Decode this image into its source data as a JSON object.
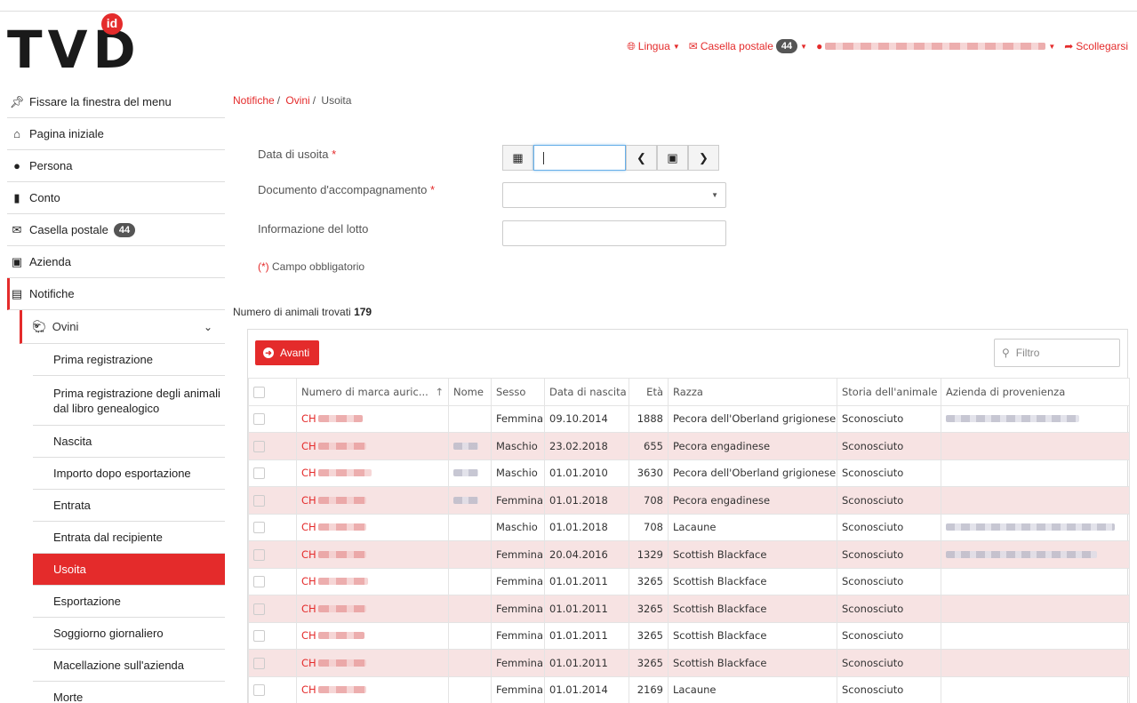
{
  "header": {
    "logo_text": "TVD",
    "logo_badge": "id",
    "lingua_label": "Lingua",
    "mailbox_label": "Casella postale",
    "mailbox_count": "44",
    "logout_label": "Scollegarsi"
  },
  "sidebar": {
    "items": [
      {
        "label": "Fissare la finestra del menu",
        "icon": "pin-icon"
      },
      {
        "label": "Pagina iniziale",
        "icon": "home-icon"
      },
      {
        "label": "Persona",
        "icon": "user-icon"
      },
      {
        "label": "Conto",
        "icon": "money-icon"
      },
      {
        "label": "Casella postale",
        "icon": "mail-icon",
        "badge": "44"
      },
      {
        "label": "Azienda",
        "icon": "factory-icon"
      },
      {
        "label": "Notifiche",
        "icon": "clipboard-icon"
      }
    ],
    "submenu": {
      "label": "Ovini",
      "icon": "sheep-icon"
    },
    "leaves": [
      "Prima registrazione",
      "Prima registrazione degli animali dal libro genealogico",
      "Nascita",
      "Importo dopo esportazione",
      "Entrata",
      "Entrata dal recipiente",
      "Usoita",
      "Esportazione",
      "Soggiorno giornaliero",
      "Macellazione sull'azienda",
      "Morte"
    ],
    "active_leaf": "Usoita"
  },
  "breadcrumb": [
    "Notifiche",
    "Ovini",
    "Usoita"
  ],
  "form": {
    "date_label": "Data di usoita",
    "doc_label": "Documento d'accompagnamento",
    "lot_label": "Informazione del lotto",
    "required_marker": "*",
    "note_marker": "(*)",
    "note": "Campo obbligatorio"
  },
  "results": {
    "count_label": "Numero di animali trovati",
    "count": "179",
    "avanti_label": "Avanti",
    "filter_placeholder": "Filtro"
  },
  "table": {
    "columns": [
      "",
      "Numero di marca auric...",
      "Nome",
      "Sesso",
      "Data di nascita",
      "Età",
      "Razza",
      "Storia dell'animale",
      "Azienda di provenienza"
    ],
    "rows": [
      {
        "id": "CH",
        "sex": "Femmina",
        "dob": "09.10.2014",
        "age": "1888",
        "breed": "Pecora dell'Oberland grigionese",
        "history": "Sconosciuto"
      },
      {
        "id": "CH",
        "sex": "Maschio",
        "dob": "23.02.2018",
        "age": "655",
        "breed": "Pecora engadinese",
        "history": "Sconosciuto"
      },
      {
        "id": "CH",
        "sex": "Maschio",
        "dob": "01.01.2010",
        "age": "3630",
        "breed": "Pecora dell'Oberland grigionese",
        "history": "Sconosciuto"
      },
      {
        "id": "CH",
        "sex": "Femmina",
        "dob": "01.01.2018",
        "age": "708",
        "breed": "Pecora engadinese",
        "history": "Sconosciuto"
      },
      {
        "id": "CH",
        "sex": "Maschio",
        "dob": "01.01.2018",
        "age": "708",
        "breed": "Lacaune",
        "history": "Sconosciuto"
      },
      {
        "id": "CH",
        "sex": "Femmina",
        "dob": "20.04.2016",
        "age": "1329",
        "breed": "Scottish Blackface",
        "history": "Sconosciuto"
      },
      {
        "id": "CH",
        "sex": "Femmina",
        "dob": "01.01.2011",
        "age": "3265",
        "breed": "Scottish Blackface",
        "history": "Sconosciuto"
      },
      {
        "id": "CH",
        "sex": "Femmina",
        "dob": "01.01.2011",
        "age": "3265",
        "breed": "Scottish Blackface",
        "history": "Sconosciuto"
      },
      {
        "id": "CH",
        "sex": "Femmina",
        "dob": "01.01.2011",
        "age": "3265",
        "breed": "Scottish Blackface",
        "history": "Sconosciuto"
      },
      {
        "id": "CH",
        "sex": "Femmina",
        "dob": "01.01.2011",
        "age": "3265",
        "breed": "Scottish Blackface",
        "history": "Sconosciuto"
      },
      {
        "id": "CH",
        "sex": "Femmina",
        "dob": "01.01.2014",
        "age": "2169",
        "breed": "Lacaune",
        "history": "Sconosciuto"
      }
    ]
  },
  "colors": {
    "accent": "#e42b2b",
    "row_alt": "#f7e3e3"
  }
}
